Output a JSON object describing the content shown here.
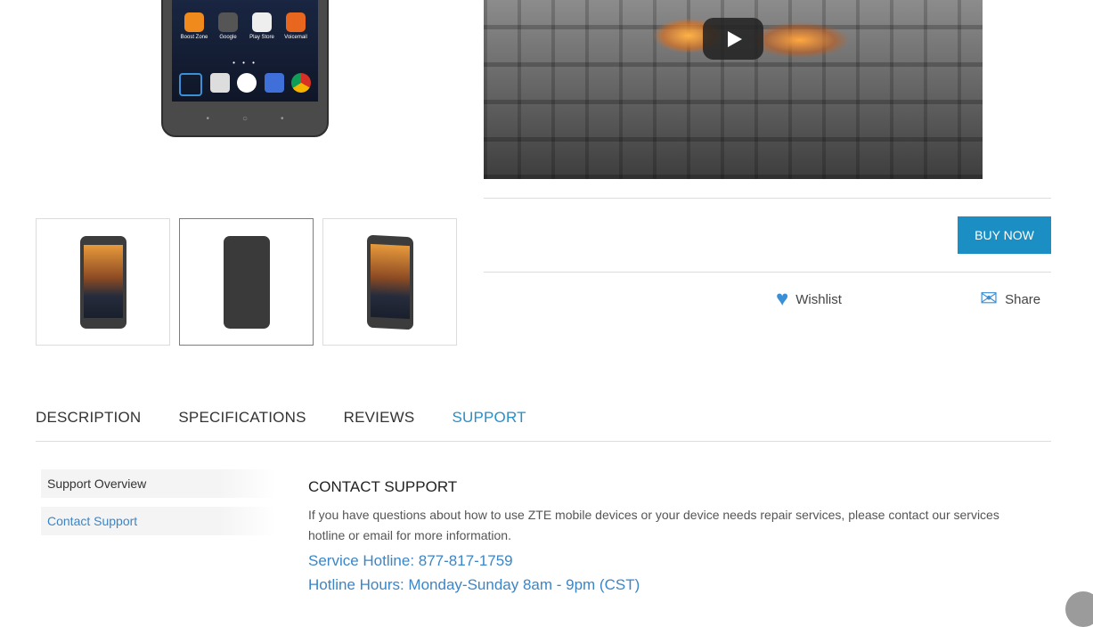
{
  "phone_apps": [
    "Boost Zone",
    "Google",
    "Play Store",
    "Voicemail"
  ],
  "video": {
    "play_label": "Play video"
  },
  "buy_now": "BUY NOW",
  "actions": {
    "wishlist": "Wishlist",
    "share": "Share"
  },
  "tabs": [
    {
      "label": "DESCRIPTION"
    },
    {
      "label": "SPECIFICATIONS"
    },
    {
      "label": "REVIEWS"
    },
    {
      "label": "SUPPORT"
    }
  ],
  "support_nav": [
    {
      "label": "Support Overview"
    },
    {
      "label": "Contact Support"
    }
  ],
  "contact": {
    "heading": "CONTACT SUPPORT",
    "body": "If you have questions about how to use ZTE mobile devices or your device needs repair services, please contact our services hotline or email for more information.",
    "hotline": "Service Hotline: 877-817-1759",
    "hours": "Hotline Hours: Monday-Sunday 8am - 9pm (CST)"
  },
  "colors": {
    "accent": "#1b8fc4",
    "link": "#3a86c8",
    "active_thumb": "#2aa0a6"
  }
}
